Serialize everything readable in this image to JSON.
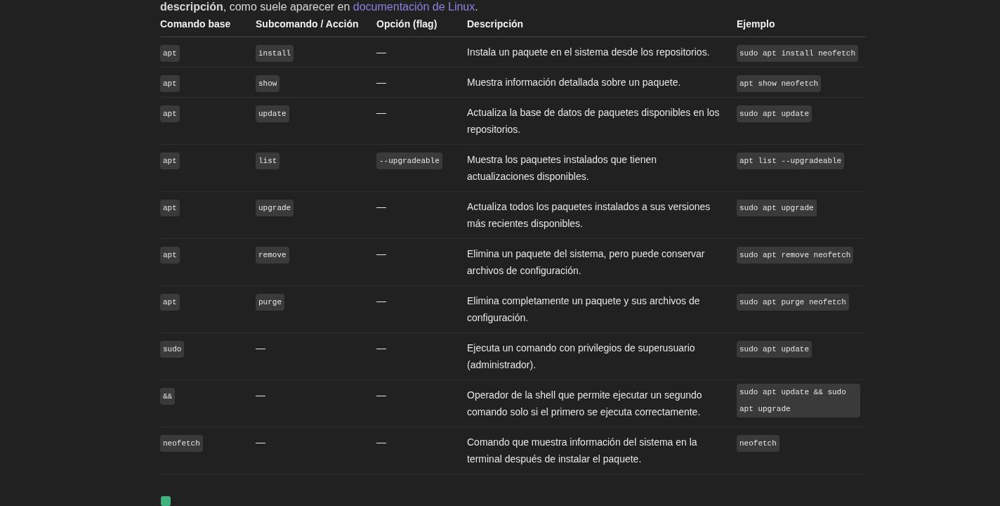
{
  "intro": {
    "lead": "**descripción**, como suele aparecer en ",
    "link": "documentación de Linux",
    "tail": "."
  },
  "table": {
    "columns": [
      "Comando base",
      "Subcomando / Acción",
      "Opción (flag)",
      "Descripción",
      "Ejemplo"
    ],
    "rows": [
      [
        {
          "kind": "code",
          "text": "apt"
        },
        {
          "kind": "code",
          "text": "install"
        },
        {
          "kind": "text",
          "text": "—"
        },
        {
          "kind": "text",
          "text": "Instala un paquete en el sistema desde los repositorios."
        },
        {
          "kind": "code",
          "text": "sudo apt install neofetch"
        }
      ],
      [
        {
          "kind": "code",
          "text": "apt"
        },
        {
          "kind": "code",
          "text": "show"
        },
        {
          "kind": "text",
          "text": "—"
        },
        {
          "kind": "text",
          "text": "Muestra información detallada sobre un paquete."
        },
        {
          "kind": "code",
          "text": "apt show neofetch"
        }
      ],
      [
        {
          "kind": "code",
          "text": "apt"
        },
        {
          "kind": "code",
          "text": "update"
        },
        {
          "kind": "text",
          "text": "—"
        },
        {
          "kind": "text",
          "text": "Actualiza la base de datos de paquetes disponibles en los repositorios."
        },
        {
          "kind": "code",
          "text": "sudo apt update"
        }
      ],
      [
        {
          "kind": "code",
          "text": "apt"
        },
        {
          "kind": "code",
          "text": "list"
        },
        {
          "kind": "code",
          "text": "--upgradeable"
        },
        {
          "kind": "text",
          "text": "Muestra los paquetes instalados que tienen actualizaciones disponibles."
        },
        {
          "kind": "code",
          "text": "apt list --upgradeable"
        }
      ],
      [
        {
          "kind": "code",
          "text": "apt"
        },
        {
          "kind": "code",
          "text": "upgrade"
        },
        {
          "kind": "text",
          "text": "—"
        },
        {
          "kind": "text",
          "text": "Actualiza todos los paquetes instalados a sus versiones más recientes disponibles."
        },
        {
          "kind": "code",
          "text": "sudo apt upgrade"
        }
      ],
      [
        {
          "kind": "code",
          "text": "apt"
        },
        {
          "kind": "code",
          "text": "remove"
        },
        {
          "kind": "text",
          "text": "—"
        },
        {
          "kind": "text",
          "text": "Elimina un paquete del sistema, pero puede conservar archivos de configuración."
        },
        {
          "kind": "code",
          "text": "sudo apt remove neofetch"
        }
      ],
      [
        {
          "kind": "code",
          "text": "apt"
        },
        {
          "kind": "code",
          "text": "purge"
        },
        {
          "kind": "text",
          "text": "—"
        },
        {
          "kind": "text",
          "text": "Elimina completamente un paquete y sus archivos de configuración."
        },
        {
          "kind": "code",
          "text": "sudo apt purge neofetch"
        }
      ],
      [
        {
          "kind": "code",
          "text": "sudo"
        },
        {
          "kind": "text",
          "text": "—"
        },
        {
          "kind": "text",
          "text": "—"
        },
        {
          "kind": "text",
          "text": "Ejecuta un comando con privilegios de superusuario (administrador)."
        },
        {
          "kind": "code",
          "text": "sudo apt update"
        }
      ],
      [
        {
          "kind": "code",
          "text": "&&"
        },
        {
          "kind": "text",
          "text": "—"
        },
        {
          "kind": "text",
          "text": "—"
        },
        {
          "kind": "text",
          "text": "Operador de la shell que permite ejecutar un segundo comando solo si el primero se ejecuta correctamente."
        },
        {
          "kind": "code",
          "text": "sudo apt update && sudo apt upgrade"
        }
      ],
      [
        {
          "kind": "code",
          "text": "neofetch"
        },
        {
          "kind": "text",
          "text": "—"
        },
        {
          "kind": "text",
          "text": "—"
        },
        {
          "kind": "text",
          "text": "Comando que muestra información del sistema en la terminal después de instalar el paquete."
        },
        {
          "kind": "code",
          "text": "neofetch"
        }
      ]
    ]
  }
}
